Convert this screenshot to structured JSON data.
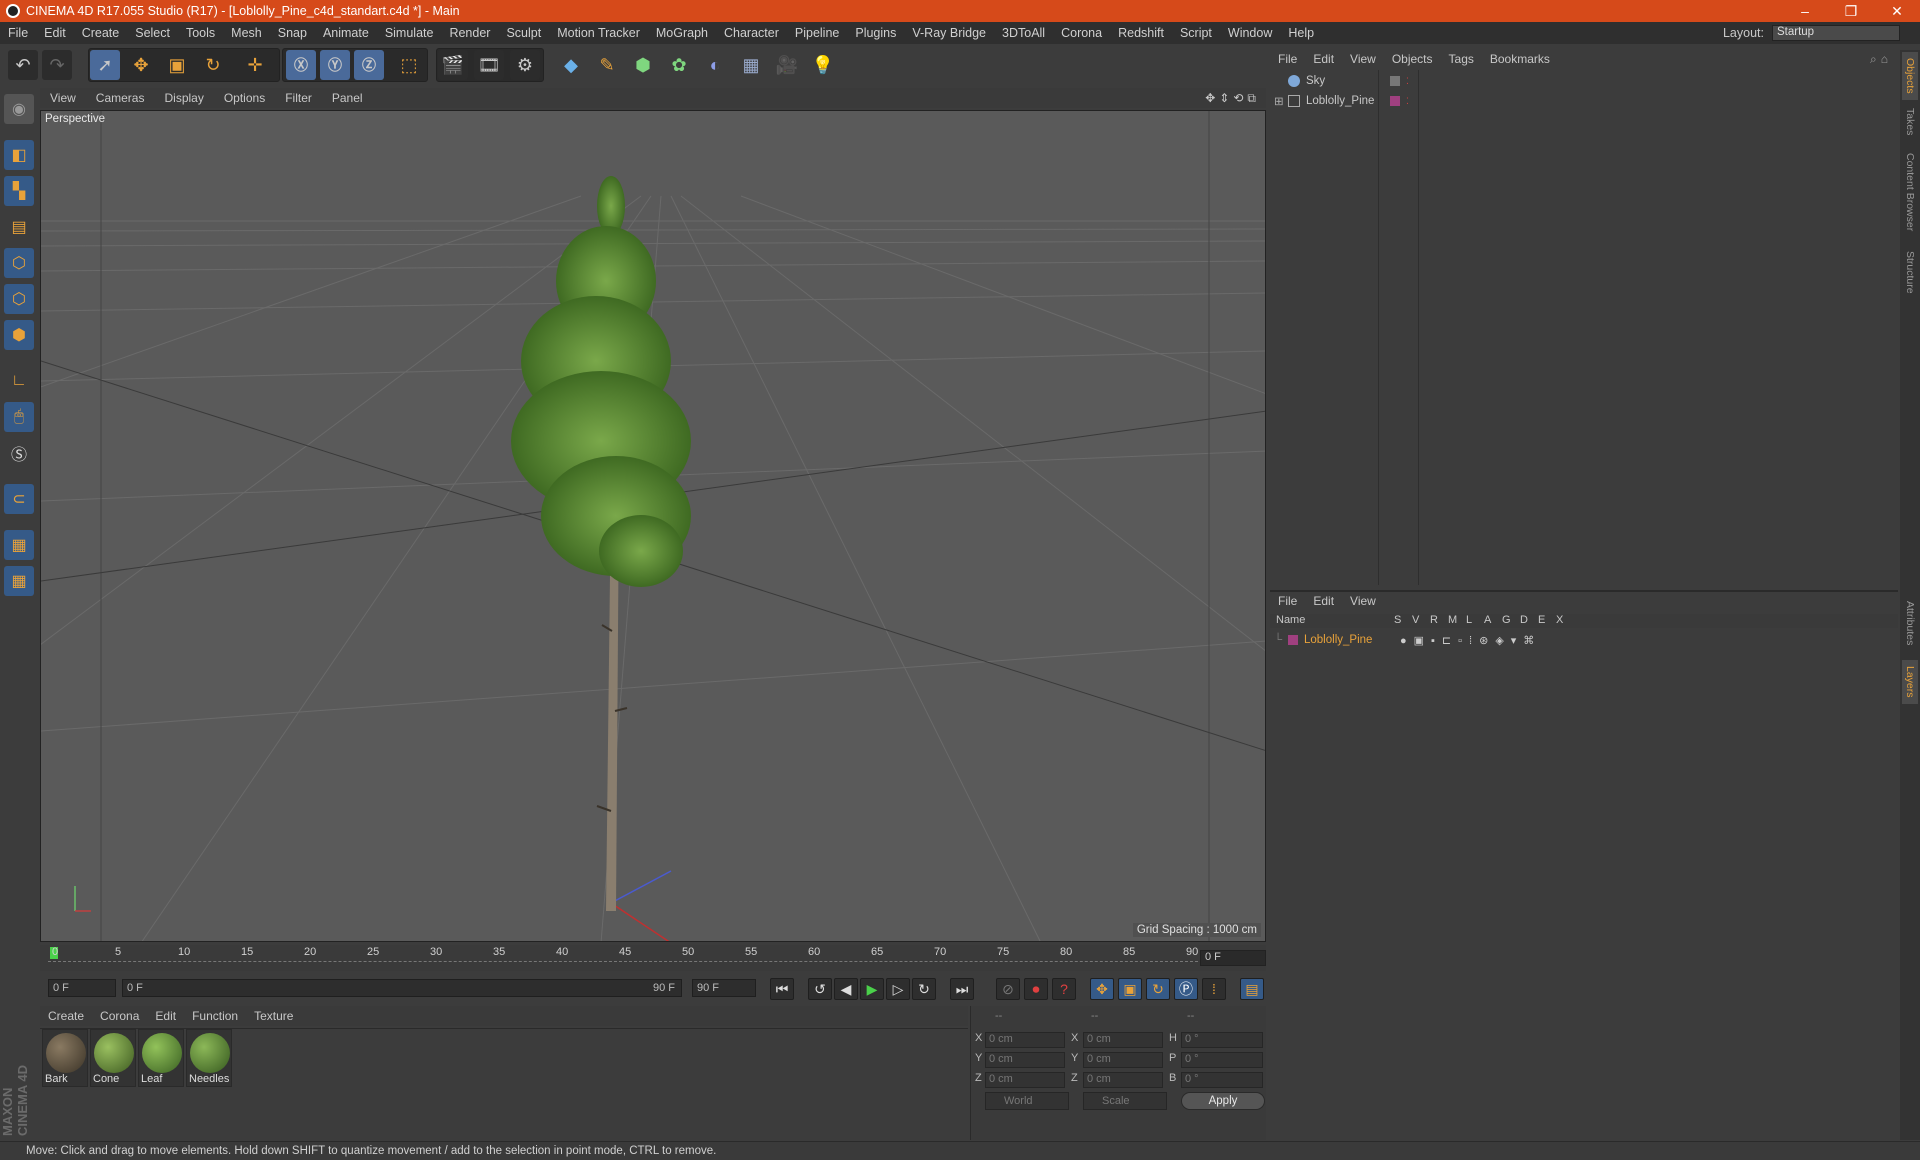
{
  "window": {
    "title": "CINEMA 4D R17.055 Studio (R17) - [Loblolly_Pine_c4d_standart.c4d *] - Main",
    "buttons": [
      "–",
      "❐",
      "✕"
    ]
  },
  "menubar": {
    "items": [
      "File",
      "Edit",
      "Create",
      "Select",
      "Tools",
      "Mesh",
      "Snap",
      "Animate",
      "Simulate",
      "Render",
      "Sculpt",
      "Motion Tracker",
      "MoGraph",
      "Character",
      "Pipeline",
      "Plugins",
      "V-Ray Bridge",
      "3DToAll",
      "Corona",
      "Redshift",
      "Script",
      "Window",
      "Help"
    ],
    "layout_label": "Layout:",
    "layout_value": "Startup"
  },
  "viewport": {
    "menu": [
      "View",
      "Cameras",
      "Display",
      "Options",
      "Filter",
      "Panel"
    ],
    "label": "Perspective",
    "grid_spacing": "Grid Spacing : 1000 cm"
  },
  "timeline": {
    "ticks": [
      "0",
      "5",
      "10",
      "15",
      "20",
      "25",
      "30",
      "35",
      "40",
      "45",
      "50",
      "55",
      "60",
      "65",
      "70",
      "75",
      "80",
      "85",
      "90"
    ],
    "current_frame": "0 F",
    "start_field": "0 F",
    "range_start": "0 F",
    "range_end": "90 F",
    "end_field": "90 F"
  },
  "materials": {
    "menu": [
      "Create",
      "Corona",
      "Edit",
      "Function",
      "Texture"
    ],
    "items": [
      {
        "name": "Bark",
        "color": "#5e5140"
      },
      {
        "name": "Cone",
        "color": "#6f8a3a"
      },
      {
        "name": "Leaf",
        "color": "#6a9a3e"
      },
      {
        "name": "Needles",
        "color": "#5f8a3a"
      }
    ]
  },
  "coords": {
    "header": [
      "--",
      "--",
      "--"
    ],
    "rows": [
      {
        "a1": "X",
        "v1": "0 cm",
        "a2": "X",
        "v2": "0 cm",
        "a3": "H",
        "v3": "0 °"
      },
      {
        "a1": "Y",
        "v1": "0 cm",
        "a2": "Y",
        "v2": "0 cm",
        "a3": "P",
        "v3": "0 °"
      },
      {
        "a1": "Z",
        "v1": "0 cm",
        "a2": "Z",
        "v2": "0 cm",
        "a3": "B",
        "v3": "0 °"
      }
    ],
    "mode1": "World",
    "mode2": "Scale",
    "apply": "Apply"
  },
  "objects": {
    "menu": [
      "File",
      "Edit",
      "View",
      "Objects",
      "Tags",
      "Bookmarks"
    ],
    "items": [
      {
        "name": "Sky"
      },
      {
        "name": "Loblolly_Pine"
      }
    ]
  },
  "layers": {
    "menu": [
      "File",
      "Edit",
      "View"
    ],
    "columns": [
      "Name",
      "S",
      "V",
      "R",
      "M",
      "L",
      "A",
      "G",
      "D",
      "E",
      "X"
    ],
    "items": [
      {
        "name": "Loblolly_Pine",
        "color": "#e8a23a"
      }
    ]
  },
  "right_tabs": [
    "Objects",
    "Takes",
    "Content Browser",
    "Structure",
    "Attributes",
    "Layers"
  ],
  "status": "Move: Click and drag to move elements. Hold down SHIFT to quantize movement / add to the selection in point mode, CTRL to remove.",
  "brand": "MAXON CINEMA 4D",
  "colors": {
    "title_bar": "#d64a1a",
    "accent": "#e8a23a",
    "viewport": "#5a5a5a"
  }
}
